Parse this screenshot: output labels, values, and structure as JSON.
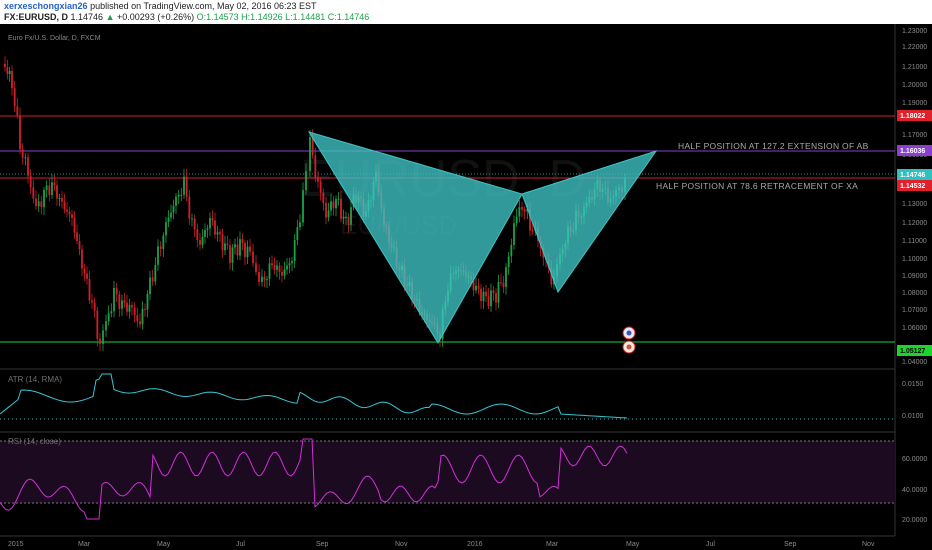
{
  "header": {
    "author": "xerxeschongxian26",
    "published_text": "published on TradingView.com, May 02, 2016 06:23 EST",
    "symbol": "FX:EURUSD, D",
    "last": "1.14746",
    "change_arrow": "▲",
    "change": "+0.00293 (+0.26%)",
    "ohlc": "O:1.14573 H:1.14926 L:1.14481 C:1.14746"
  },
  "chart": {
    "title": "Euro Fx/U.S. Dollar, D, FXCM",
    "watermark": "EURUSD, D",
    "watermark_sub": "EUR/USD",
    "annotations": {
      "ext_label": "HALF POSITION AT 127.2 EXTENSION OF AB",
      "retr_label": "HALF POSITION AT 78.6 RETRACEMENT OF XA"
    },
    "price_axis": {
      "ticks": [
        "1.23000",
        "1.22000",
        "1.21000",
        "1.20000",
        "1.19000",
        "1.17000",
        "1.16000",
        "1.13000",
        "1.12000",
        "1.11000",
        "1.10000",
        "1.09000",
        "1.08000",
        "1.07000",
        "1.06000",
        "1.04000"
      ],
      "tags": [
        {
          "label": "1.18022",
          "color": "#e0202a"
        },
        {
          "label": "1.16036",
          "color": "#8a3fd1"
        },
        {
          "label": "1.14746",
          "color": "#2fc0c0"
        },
        {
          "label": "1.14532",
          "color": "#e0202a"
        },
        {
          "label": "1.05127",
          "color": "#1bd42c"
        }
      ]
    },
    "time_axis": [
      "2015",
      "Mar",
      "May",
      "Jul",
      "Sep",
      "Nov",
      "2016",
      "Mar",
      "May",
      "Jul",
      "Sep",
      "Nov"
    ],
    "atr": {
      "title": "ATR (14, RMA)",
      "ticks": [
        "0.0150",
        "0.0100"
      ]
    },
    "rsi": {
      "title": "RSI (14, close)",
      "ticks": [
        "60.0000",
        "40.0000",
        "20.0000"
      ]
    },
    "colors": {
      "up": "#1aa34a",
      "down": "#d0212b",
      "pattern": "#3fc4c4",
      "atr": "#35c6d6",
      "rsi": "#d230d8",
      "resistance": "#d0212b",
      "support": "#1bd42c",
      "extension": "#8a3fd1"
    },
    "icons": [
      "event-icon-1",
      "event-icon-2"
    ]
  }
}
